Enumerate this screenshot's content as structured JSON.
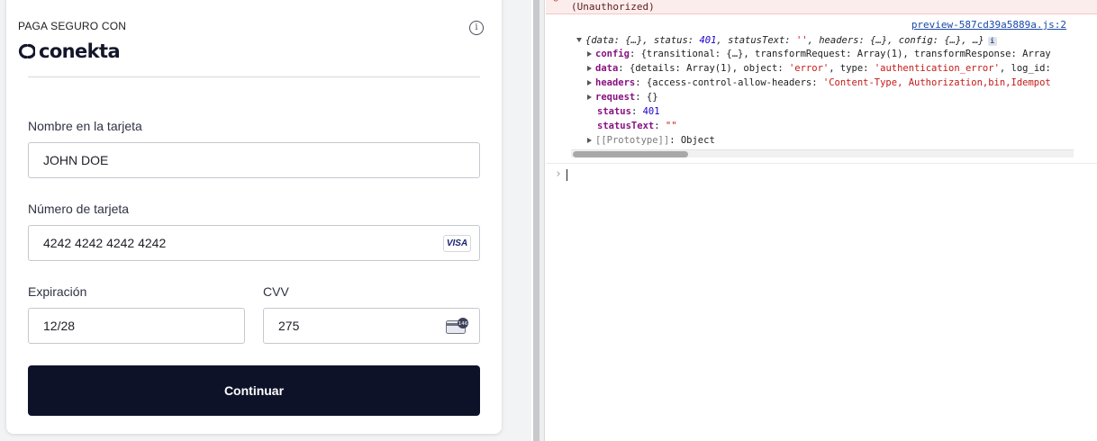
{
  "payment": {
    "secure_caption": "PAGA SEGURO CON",
    "brand_name": "conekta",
    "info_icon": "info-circle-icon",
    "fields": {
      "name_label": "Nombre en la tarjeta",
      "name_value": "JOHN DOE",
      "number_label": "Número de tarjeta",
      "number_value": "4242 4242 4242 4242",
      "card_brand": "VISA",
      "expiry_label": "Expiración",
      "expiry_value": "12/28",
      "cvv_label": "CVV",
      "cvv_value": "275",
      "cvv_icon_text": "146"
    },
    "continue_label": "Continuar"
  },
  "console": {
    "error_text": "(Unauthorized)",
    "source_link": "preview-587cd39a5889a.js:2",
    "summary": {
      "data": "{…}",
      "status": "401",
      "statusText": "''",
      "headers": "{…}",
      "config": "{…}",
      "ellipsis": "…"
    },
    "props": {
      "config_key": "config",
      "config_val": "{transitional: {…}, transformRequest: Array(1), transformResponse: Array",
      "data_key": "data",
      "data_val_a": "{details: Array(1), object: ",
      "data_object": "'error'",
      "data_val_b": ", type: ",
      "data_type": "'authentication_error'",
      "data_val_c": ", log_id:",
      "headers_key": "headers",
      "headers_val_a": "{access-control-allow-headers: ",
      "headers_val_str": "'Content-Type, Authorization,bin,Idempot",
      "request_key": "request",
      "request_val": "{}",
      "status_key": "status",
      "status_val": "401",
      "statusText_key": "statusText",
      "statusText_val": "\"\"",
      "prototype_key": "[[Prototype]]",
      "prototype_val": "Object"
    }
  },
  "colors": {
    "button_bg": "#0e1228",
    "string": "#c41a16",
    "number": "#1c00cf",
    "key": "#881280",
    "link": "#1a48a8"
  }
}
